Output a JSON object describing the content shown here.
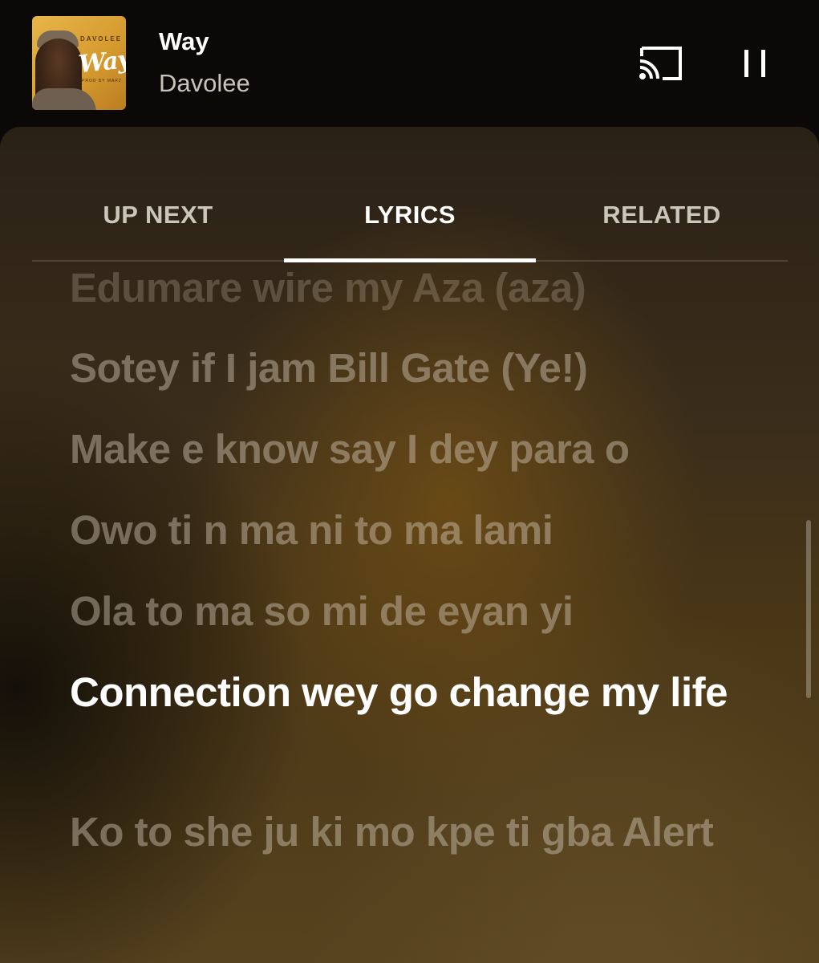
{
  "mini_player": {
    "album_art": {
      "artist_text": "DAVOLEE",
      "title_text": "Way",
      "sub_text": "PROD BY MARZ"
    },
    "song_title": "Way",
    "artist": "Davolee"
  },
  "tabs": [
    {
      "label": "UP NEXT",
      "selected": false
    },
    {
      "label": "LYRICS",
      "selected": true
    },
    {
      "label": "RELATED",
      "selected": false
    }
  ],
  "lyrics": [
    {
      "text": "Edumare wire my Aza (aza)",
      "state": "faded"
    },
    {
      "text": "Sotey if I jam Bill Gate (Ye!)",
      "state": "inactive"
    },
    {
      "text": "Make e know say I dey para o",
      "state": "inactive"
    },
    {
      "text": "Owo ti n ma ni to ma lami",
      "state": "inactive"
    },
    {
      "text": "Ola to ma so mi de eyan yi",
      "state": "inactive"
    },
    {
      "text": "Connection wey go change my life",
      "state": "active"
    },
    {
      "text": "Ko to she ju ki mo kpe ti gba Alert",
      "state": "inactive"
    }
  ],
  "colors": {
    "active_text": "#ffffff",
    "inactive_text": "#d2c8b9",
    "accent_indicator": "#ffffff"
  },
  "icons": {
    "cast": "cast-icon",
    "pause": "pause-icon"
  }
}
